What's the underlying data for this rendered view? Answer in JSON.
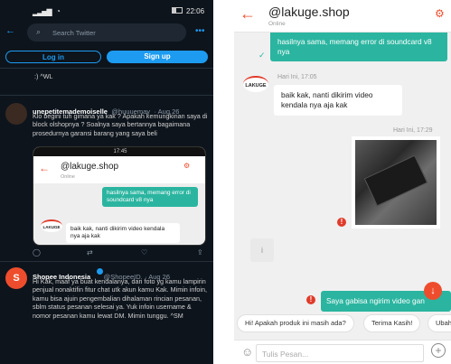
{
  "status": {
    "time": "22:06"
  },
  "twitter": {
    "search_placeholder": "Search Twitter",
    "login": "Log in",
    "signup": "Sign up",
    "prev_text": ":) ^WL",
    "t1": {
      "name": "unepetitemademoiselle",
      "handle": "@huuuemay",
      "date": "· Aug 26",
      "body": "Klo begini tuh gimana ya kak ? Apakah kemungkinan saya di block olshopnya ? Soalnya saya bertannya bagaimana prosedurnya garansi barang yang saya beli"
    },
    "emb": {
      "time": "17:45",
      "title": "@lakuge.shop",
      "sub": "Online",
      "msg": "hasilnya sama, memang error di soundcard v8 nya",
      "reply": "baik kak, nanti dikirim video kendala nya aja kak"
    },
    "t2": {
      "name": "Shopee Indonesia",
      "handle": "@ShopeeID",
      "date": "· Aug 26",
      "body": "Hi Kak, maaf ya buat kendalanya, dari foto yg kamu lampirin penjual nonaktifin fitur chat utk akun kamu Kak. Mimin infoin, kamu bisa ajuin pengembalian dihalaman rincian pesanan, sblm status pesanan selesai ya. Yuk infoin username & nomor pesanan kamu lewat DM. Mimin tunggu. ^SM"
    }
  },
  "chat": {
    "title": "@lakuge.shop",
    "sub": "Online",
    "msg1": "hasilnya sama, memang error di soundcard v8 nya",
    "time1": "Hari Ini, 17:05",
    "msg2": "baik kak, nanti dikirim video kendala nya aja kak",
    "time2": "Hari Ini, 17:29",
    "msg3": "Saya gabisa ngirim video gan",
    "chips": [
      "Hi! Apakah produk ini masih ada?",
      "Terima Kasih!",
      "Ubah"
    ],
    "input_placeholder": "Tulis Pesan...",
    "logo_text": "LAKUGE"
  },
  "colors": {
    "accent": "#ee4d2d",
    "teal": "#2bb5a0",
    "twitter_blue": "#1d9bf0"
  }
}
